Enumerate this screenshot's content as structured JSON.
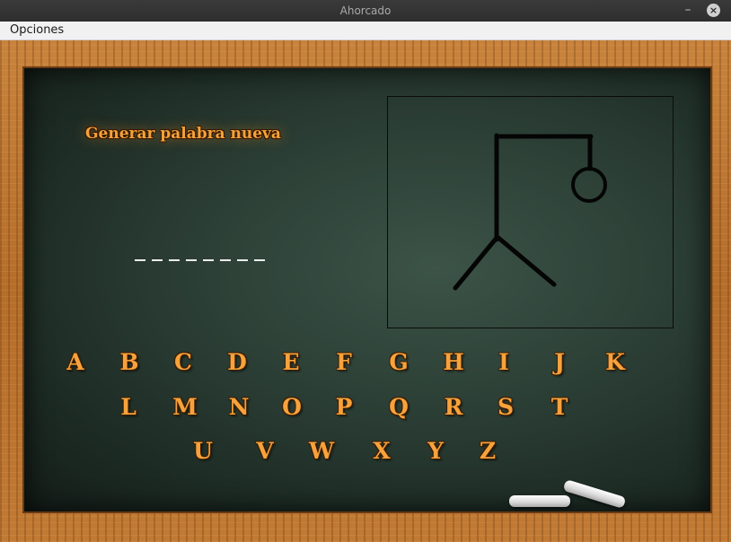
{
  "window": {
    "title": "Ahorcado"
  },
  "menubar": {
    "items": [
      {
        "label": "Opciones"
      }
    ]
  },
  "board": {
    "generate_label": "Generar palabra nueva",
    "word_slots": [
      "_",
      "_",
      "_",
      "_",
      "_",
      "_",
      "_",
      "_"
    ]
  },
  "gallows": {
    "stage": "head-and-legs-drawn",
    "parts_shown": [
      "post",
      "beam",
      "rope",
      "head",
      "body-left-leg",
      "body-right-leg"
    ]
  },
  "letters": {
    "row1": [
      "A",
      "B",
      "C",
      "D",
      "E",
      "F",
      "G",
      "H",
      "I",
      "J",
      "K"
    ],
    "row2": [
      "L",
      "M",
      "N",
      "O",
      "P",
      "Q",
      "R",
      "S",
      "T"
    ],
    "row3": [
      "U",
      "V",
      "W",
      "X",
      "Y",
      "Z"
    ]
  },
  "colors": {
    "letter": "#f7a23c",
    "board": "#2e4238",
    "frame": "#c17a34"
  }
}
